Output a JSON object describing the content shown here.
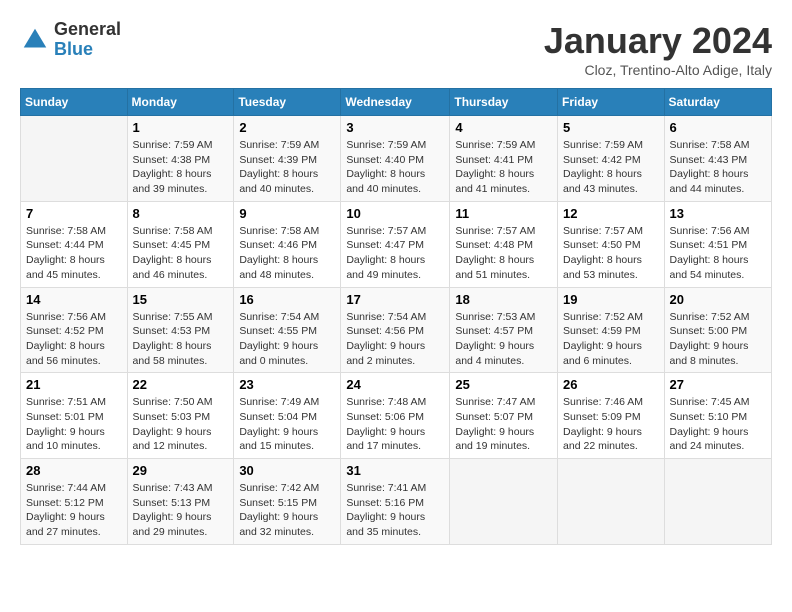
{
  "header": {
    "logo_general": "General",
    "logo_blue": "Blue",
    "month_title": "January 2024",
    "subtitle": "Cloz, Trentino-Alto Adige, Italy"
  },
  "weekdays": [
    "Sunday",
    "Monday",
    "Tuesday",
    "Wednesday",
    "Thursday",
    "Friday",
    "Saturday"
  ],
  "weeks": [
    [
      {
        "day": "",
        "sunrise": "",
        "sunset": "",
        "daylight": ""
      },
      {
        "day": "1",
        "sunrise": "Sunrise: 7:59 AM",
        "sunset": "Sunset: 4:38 PM",
        "daylight": "Daylight: 8 hours and 39 minutes."
      },
      {
        "day": "2",
        "sunrise": "Sunrise: 7:59 AM",
        "sunset": "Sunset: 4:39 PM",
        "daylight": "Daylight: 8 hours and 40 minutes."
      },
      {
        "day": "3",
        "sunrise": "Sunrise: 7:59 AM",
        "sunset": "Sunset: 4:40 PM",
        "daylight": "Daylight: 8 hours and 40 minutes."
      },
      {
        "day": "4",
        "sunrise": "Sunrise: 7:59 AM",
        "sunset": "Sunset: 4:41 PM",
        "daylight": "Daylight: 8 hours and 41 minutes."
      },
      {
        "day": "5",
        "sunrise": "Sunrise: 7:59 AM",
        "sunset": "Sunset: 4:42 PM",
        "daylight": "Daylight: 8 hours and 43 minutes."
      },
      {
        "day": "6",
        "sunrise": "Sunrise: 7:58 AM",
        "sunset": "Sunset: 4:43 PM",
        "daylight": "Daylight: 8 hours and 44 minutes."
      }
    ],
    [
      {
        "day": "7",
        "sunrise": "Sunrise: 7:58 AM",
        "sunset": "Sunset: 4:44 PM",
        "daylight": "Daylight: 8 hours and 45 minutes."
      },
      {
        "day": "8",
        "sunrise": "Sunrise: 7:58 AM",
        "sunset": "Sunset: 4:45 PM",
        "daylight": "Daylight: 8 hours and 46 minutes."
      },
      {
        "day": "9",
        "sunrise": "Sunrise: 7:58 AM",
        "sunset": "Sunset: 4:46 PM",
        "daylight": "Daylight: 8 hours and 48 minutes."
      },
      {
        "day": "10",
        "sunrise": "Sunrise: 7:57 AM",
        "sunset": "Sunset: 4:47 PM",
        "daylight": "Daylight: 8 hours and 49 minutes."
      },
      {
        "day": "11",
        "sunrise": "Sunrise: 7:57 AM",
        "sunset": "Sunset: 4:48 PM",
        "daylight": "Daylight: 8 hours and 51 minutes."
      },
      {
        "day": "12",
        "sunrise": "Sunrise: 7:57 AM",
        "sunset": "Sunset: 4:50 PM",
        "daylight": "Daylight: 8 hours and 53 minutes."
      },
      {
        "day": "13",
        "sunrise": "Sunrise: 7:56 AM",
        "sunset": "Sunset: 4:51 PM",
        "daylight": "Daylight: 8 hours and 54 minutes."
      }
    ],
    [
      {
        "day": "14",
        "sunrise": "Sunrise: 7:56 AM",
        "sunset": "Sunset: 4:52 PM",
        "daylight": "Daylight: 8 hours and 56 minutes."
      },
      {
        "day": "15",
        "sunrise": "Sunrise: 7:55 AM",
        "sunset": "Sunset: 4:53 PM",
        "daylight": "Daylight: 8 hours and 58 minutes."
      },
      {
        "day": "16",
        "sunrise": "Sunrise: 7:54 AM",
        "sunset": "Sunset: 4:55 PM",
        "daylight": "Daylight: 9 hours and 0 minutes."
      },
      {
        "day": "17",
        "sunrise": "Sunrise: 7:54 AM",
        "sunset": "Sunset: 4:56 PM",
        "daylight": "Daylight: 9 hours and 2 minutes."
      },
      {
        "day": "18",
        "sunrise": "Sunrise: 7:53 AM",
        "sunset": "Sunset: 4:57 PM",
        "daylight": "Daylight: 9 hours and 4 minutes."
      },
      {
        "day": "19",
        "sunrise": "Sunrise: 7:52 AM",
        "sunset": "Sunset: 4:59 PM",
        "daylight": "Daylight: 9 hours and 6 minutes."
      },
      {
        "day": "20",
        "sunrise": "Sunrise: 7:52 AM",
        "sunset": "Sunset: 5:00 PM",
        "daylight": "Daylight: 9 hours and 8 minutes."
      }
    ],
    [
      {
        "day": "21",
        "sunrise": "Sunrise: 7:51 AM",
        "sunset": "Sunset: 5:01 PM",
        "daylight": "Daylight: 9 hours and 10 minutes."
      },
      {
        "day": "22",
        "sunrise": "Sunrise: 7:50 AM",
        "sunset": "Sunset: 5:03 PM",
        "daylight": "Daylight: 9 hours and 12 minutes."
      },
      {
        "day": "23",
        "sunrise": "Sunrise: 7:49 AM",
        "sunset": "Sunset: 5:04 PM",
        "daylight": "Daylight: 9 hours and 15 minutes."
      },
      {
        "day": "24",
        "sunrise": "Sunrise: 7:48 AM",
        "sunset": "Sunset: 5:06 PM",
        "daylight": "Daylight: 9 hours and 17 minutes."
      },
      {
        "day": "25",
        "sunrise": "Sunrise: 7:47 AM",
        "sunset": "Sunset: 5:07 PM",
        "daylight": "Daylight: 9 hours and 19 minutes."
      },
      {
        "day": "26",
        "sunrise": "Sunrise: 7:46 AM",
        "sunset": "Sunset: 5:09 PM",
        "daylight": "Daylight: 9 hours and 22 minutes."
      },
      {
        "day": "27",
        "sunrise": "Sunrise: 7:45 AM",
        "sunset": "Sunset: 5:10 PM",
        "daylight": "Daylight: 9 hours and 24 minutes."
      }
    ],
    [
      {
        "day": "28",
        "sunrise": "Sunrise: 7:44 AM",
        "sunset": "Sunset: 5:12 PM",
        "daylight": "Daylight: 9 hours and 27 minutes."
      },
      {
        "day": "29",
        "sunrise": "Sunrise: 7:43 AM",
        "sunset": "Sunset: 5:13 PM",
        "daylight": "Daylight: 9 hours and 29 minutes."
      },
      {
        "day": "30",
        "sunrise": "Sunrise: 7:42 AM",
        "sunset": "Sunset: 5:15 PM",
        "daylight": "Daylight: 9 hours and 32 minutes."
      },
      {
        "day": "31",
        "sunrise": "Sunrise: 7:41 AM",
        "sunset": "Sunset: 5:16 PM",
        "daylight": "Daylight: 9 hours and 35 minutes."
      },
      {
        "day": "",
        "sunrise": "",
        "sunset": "",
        "daylight": ""
      },
      {
        "day": "",
        "sunrise": "",
        "sunset": "",
        "daylight": ""
      },
      {
        "day": "",
        "sunrise": "",
        "sunset": "",
        "daylight": ""
      }
    ]
  ]
}
